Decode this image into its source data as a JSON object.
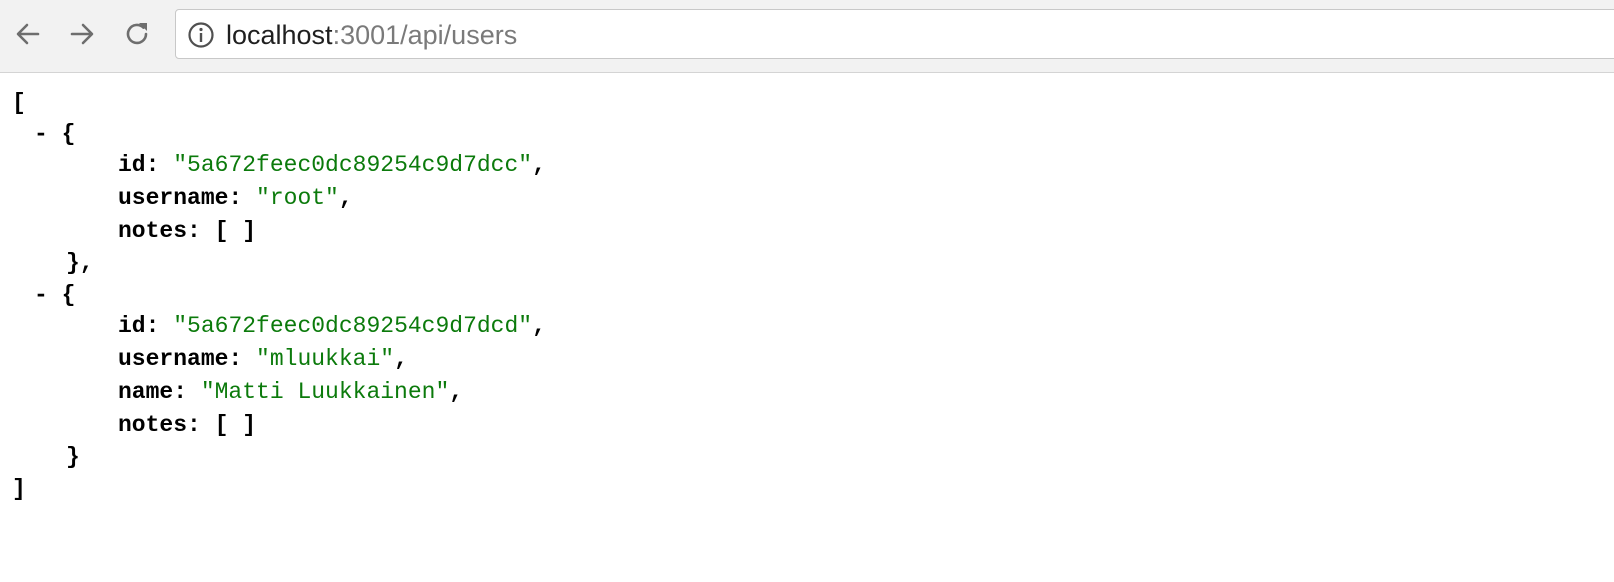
{
  "browser": {
    "url_host": "localhost",
    "url_rest": ":3001/api/users",
    "icons": {
      "back": "arrow-left-icon",
      "forward": "arrow-right-icon",
      "reload": "reload-icon",
      "info": "info-icon"
    }
  },
  "json_view": {
    "array_open": "[",
    "array_close": "]",
    "collapser": "-",
    "object_open": "{",
    "users": [
      {
        "id": "\"5a672feec0dc89254c9d7dcc\"",
        "username": "\"root\"",
        "notes": "[ ]",
        "close": "},"
      },
      {
        "id": "\"5a672feec0dc89254c9d7dcd\"",
        "username": "\"mluukkai\"",
        "name": "\"Matti Luukkainen\"",
        "notes": "[ ]",
        "close": "}"
      }
    ],
    "keys": {
      "id": "id:",
      "username": "username:",
      "name": "name:",
      "notes": "notes:"
    },
    "comma": ","
  },
  "colors": {
    "string": "#0b7a0b",
    "toolbar_bg": "#f2f2f2"
  }
}
